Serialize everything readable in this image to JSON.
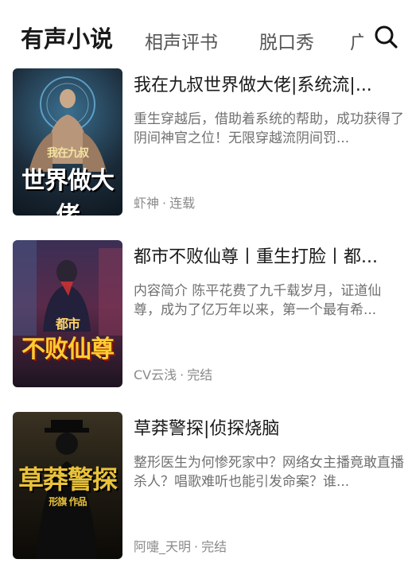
{
  "tabs": [
    {
      "label": "有声小说",
      "active": true
    },
    {
      "label": "相声评书",
      "active": false
    },
    {
      "label": "脱口秀",
      "active": false
    },
    {
      "label": "广播",
      "active": false
    }
  ],
  "search_icon": "search-icon",
  "books": [
    {
      "title": "我在九叔世界做大佬|系统流|...",
      "desc": "重生穿越后，借助着系统的帮助，成功获得了阴间神官之位！无限穿越流阴间罚...",
      "author": "虾神",
      "status": "连载",
      "cover_text": "世界做大佬",
      "cover_sub": "我在九叔",
      "cover_bg": "#1b2a38"
    },
    {
      "title": "都市不败仙尊丨重生打脸丨都...",
      "desc": "内容简介 陈平花费了九千载岁月，证道仙尊，成为了亿万年以来，第一个最有希...",
      "author": "CV云浅",
      "status": "完结",
      "cover_text": "不败仙尊",
      "cover_sub": "都市",
      "cover_bg": "#2b1d3a"
    },
    {
      "title": "草莽警探|侦探烧脑",
      "desc": "整形医生为何惨死家中？网络女主播竟敢直播杀人？唱歌难听也能引发命案？谁...",
      "author": "阿嚏_天明",
      "status": "完结",
      "cover_text": "草莽警探",
      "cover_sub": "形旗 作品",
      "cover_bg": "#1e1a12"
    }
  ],
  "separator": "·"
}
